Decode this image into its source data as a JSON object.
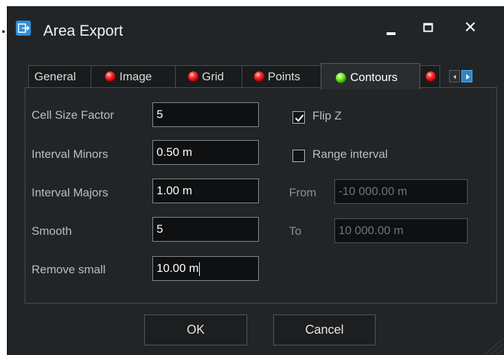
{
  "window": {
    "title": "Area Export",
    "icon": "export-icon",
    "controls": [
      "minimize-icon",
      "maximize-icon",
      "close-icon"
    ]
  },
  "tabs": [
    {
      "label": "General",
      "status": "none"
    },
    {
      "label": "Image",
      "status": "red"
    },
    {
      "label": "Grid",
      "status": "red"
    },
    {
      "label": "Points",
      "status": "red"
    },
    {
      "label": "Contours",
      "status": "green",
      "active": true
    },
    {
      "label": "",
      "status": "red",
      "partial": true
    }
  ],
  "fields": {
    "cell_size_factor": {
      "label": "Cell Size Factor",
      "value": "5"
    },
    "interval_minors": {
      "label": "Interval Minors",
      "value": "0.50 m"
    },
    "interval_majors": {
      "label": "Interval Majors",
      "value": "1.00 m"
    },
    "smooth": {
      "label": "Smooth",
      "value": "5"
    },
    "remove_small": {
      "label": "Remove small",
      "value": "10.00 m"
    }
  },
  "options": {
    "flip_z": {
      "label": "Flip Z",
      "checked": true
    },
    "range_interval": {
      "label": "Range interval",
      "checked": false
    },
    "from": {
      "label": "From",
      "value": "-10 000.00 m",
      "disabled": true
    },
    "to": {
      "label": "To",
      "value": "10 000.00 m",
      "disabled": true
    }
  },
  "buttons": {
    "ok": "OK",
    "cancel": "Cancel"
  },
  "colors": {
    "background": "#222527",
    "accent": "#2e8fd8",
    "status_red": "#e01010",
    "status_green": "#4ad400"
  }
}
